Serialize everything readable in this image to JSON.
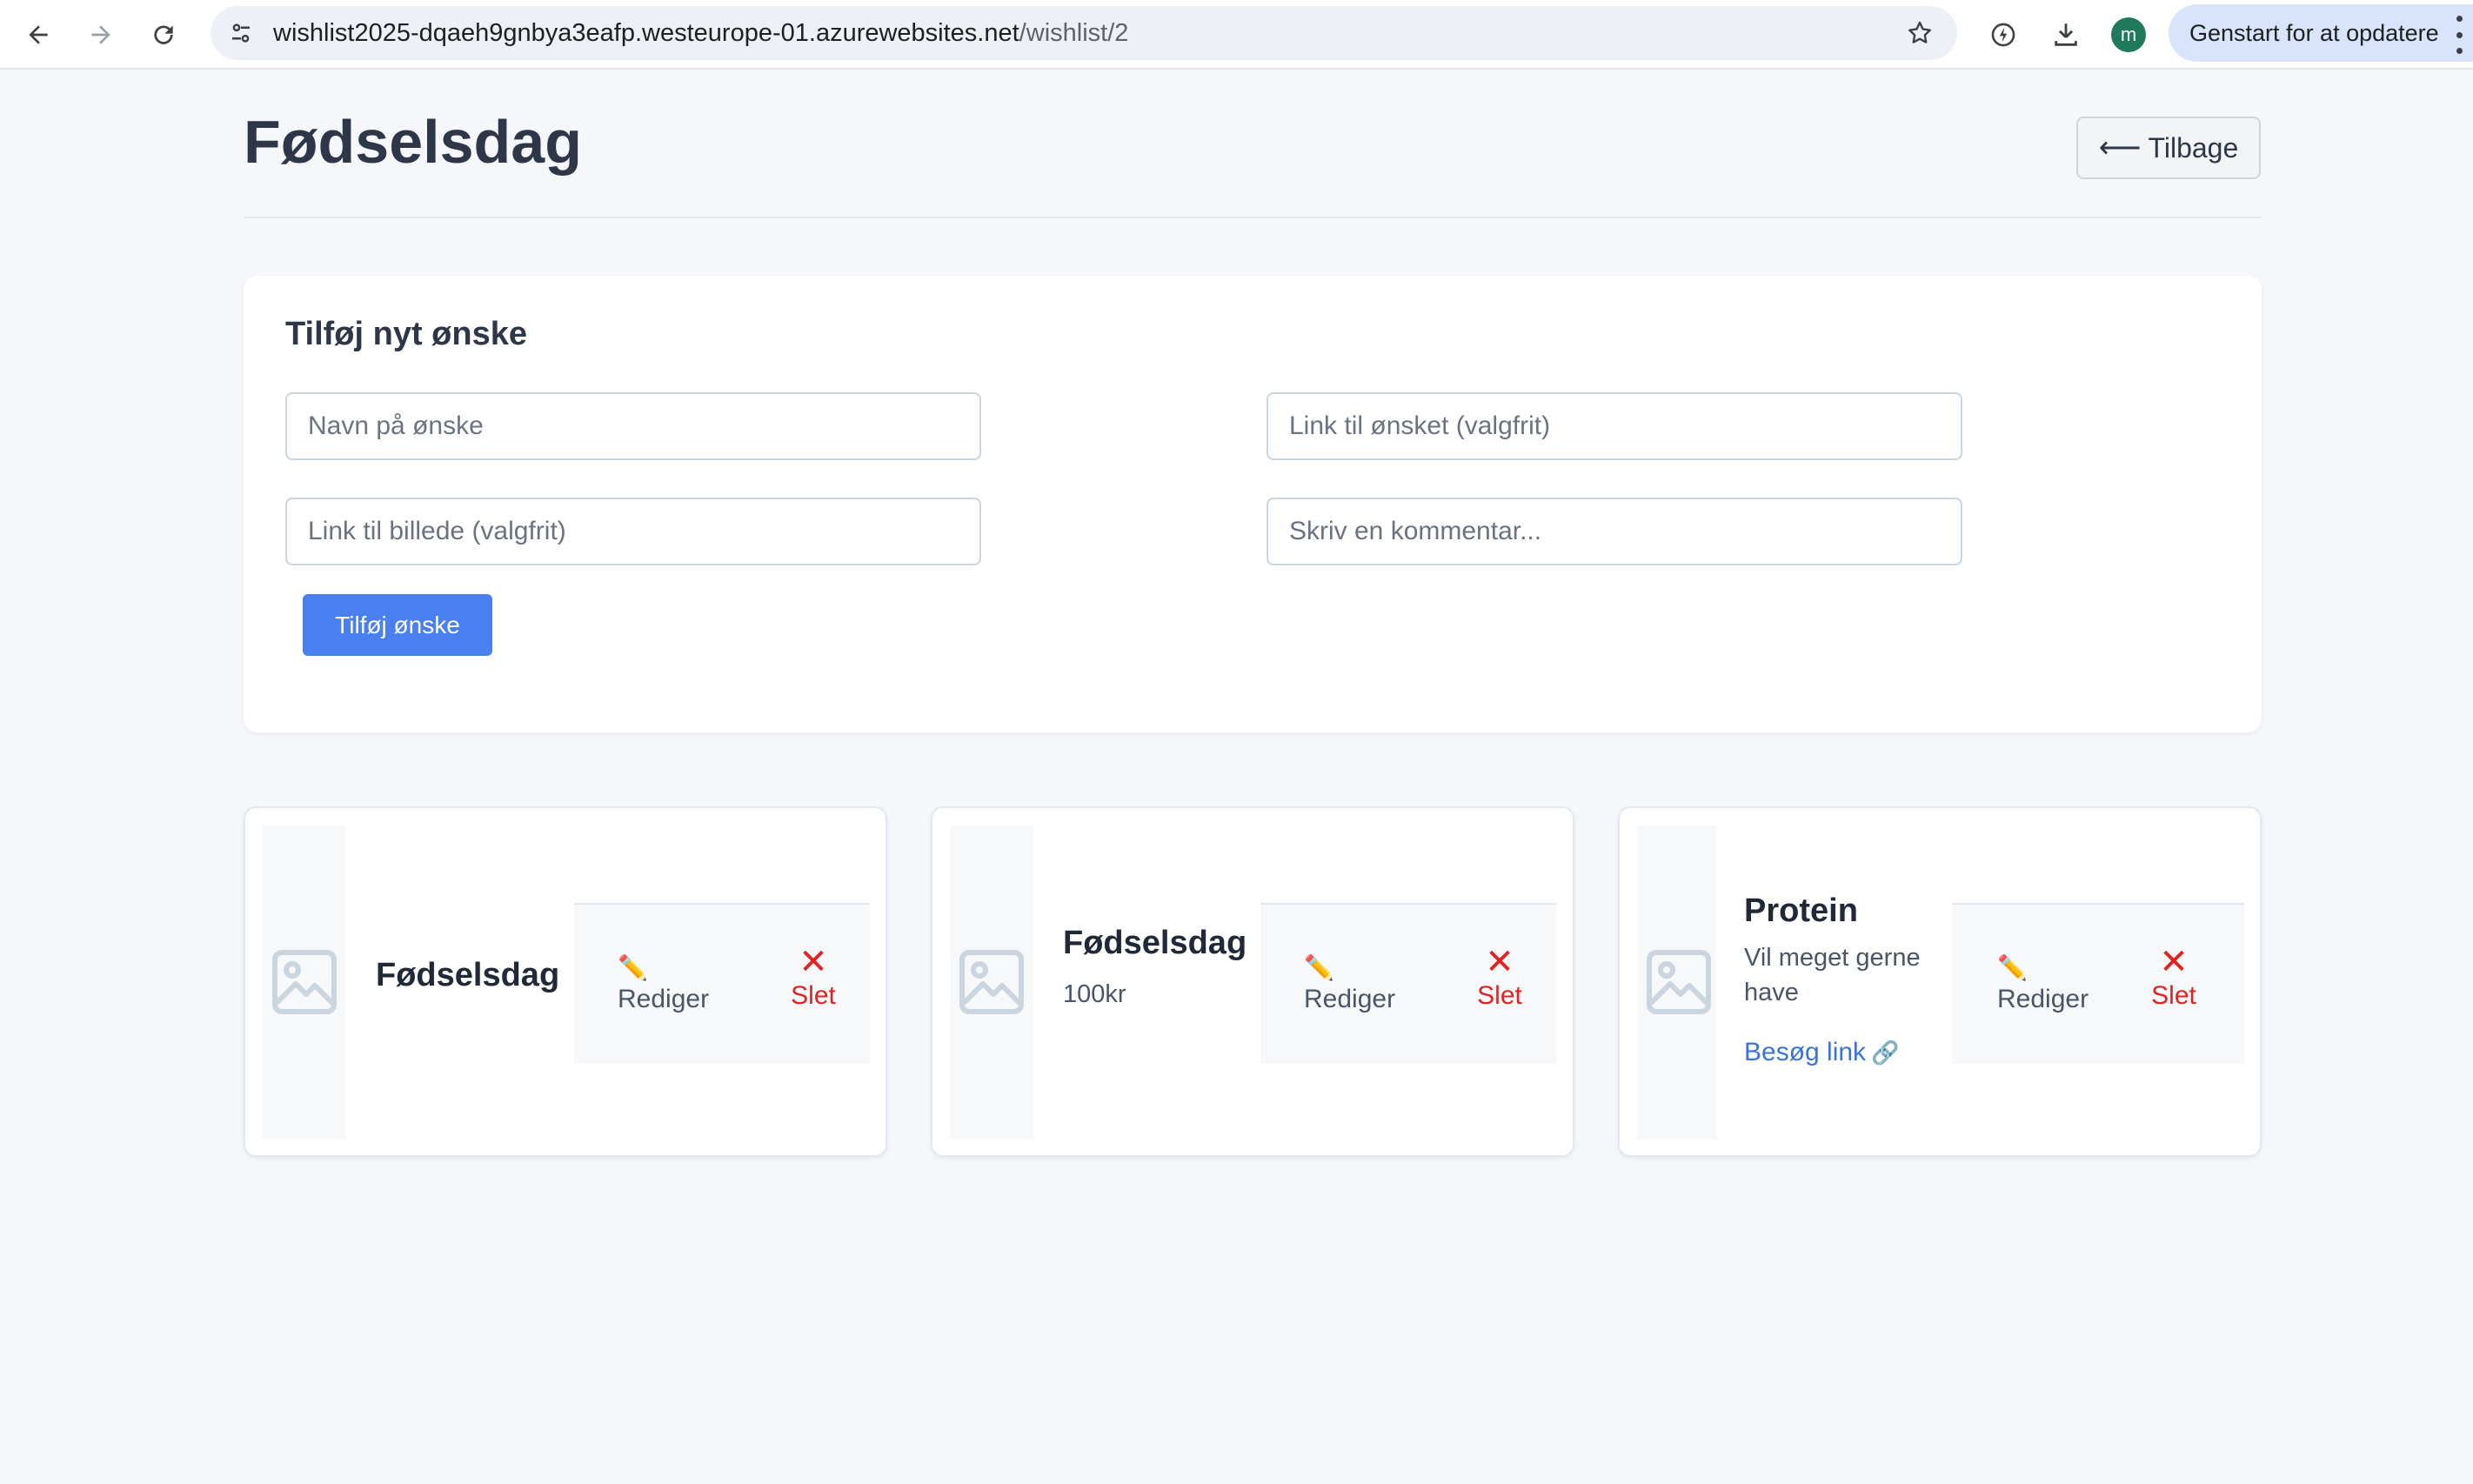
{
  "browser": {
    "url_host": "wishlist2025-dqaeh9gnbya3eafp.westeurope-01.azurewebsites.net",
    "url_path": "/wishlist/2",
    "profile_initial": "m",
    "update_label": "Genstart for at opdatere"
  },
  "page": {
    "title": "Fødselsdag",
    "back_label": "Tilbage",
    "back_arrow": "⟵"
  },
  "form": {
    "title": "Tilføj nyt ønske",
    "name_placeholder": "Navn på ønske",
    "name_value": "",
    "link_placeholder": "Link til ønsket (valgfrit)",
    "link_value": "",
    "image_placeholder": "Link til billede (valgfrit)",
    "image_value": "",
    "comment_placeholder": "Skriv en kommentar...",
    "comment_value": "",
    "submit_label": "Tilføj ønske"
  },
  "wishes": [
    {
      "name": "Fødselsdag",
      "comment": "",
      "link_label": "",
      "edit_label": "Rediger",
      "delete_label": "Slet"
    },
    {
      "name": "Fødselsdag",
      "comment": "100kr",
      "link_label": "",
      "edit_label": "Rediger",
      "delete_label": "Slet"
    },
    {
      "name": "Protein",
      "comment": "Vil meget gerne have",
      "link_label": "Besøg link",
      "edit_label": "Rediger",
      "delete_label": "Slet"
    }
  ],
  "icons": {
    "edit": "pencil-icon",
    "delete": "cross-icon",
    "link": "link-icon",
    "image_placeholder": "image-placeholder-icon"
  },
  "colors": {
    "primary_button": "#4a7fef",
    "delete_red": "#e02424",
    "link_blue": "#3b74d8",
    "page_background": "#f5f7fa"
  }
}
